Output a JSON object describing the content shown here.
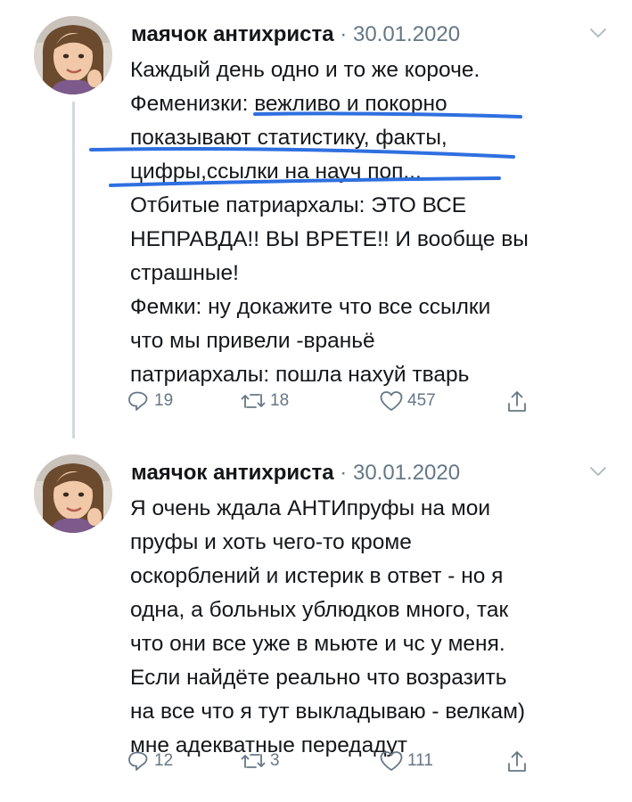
{
  "tweets": [
    {
      "author_name": "маячок антихриста",
      "separator": "·",
      "date": "30.01.2020",
      "lines": [
        "Каждый день одно и то же короче.",
        "Феменизки: вежливо и покорно",
        "показывают статистику, факты,",
        "цифры,ссылки на науч поп...",
        "Отбитые патриархалы: ЭТО ВСЕ",
        "НЕПРАВДА!! ВЫ ВРЕТЕ!! И вообще вы",
        "страшные!",
        "Фемки: ну докажите что все ссылки",
        "что мы привели -враньё",
        "патриархалы: пошла нахуй тварь"
      ],
      "replies": "19",
      "retweets": "18",
      "likes": "457",
      "icons": {
        "reply": "reply-icon",
        "retweet": "retweet-icon",
        "like": "heart-icon",
        "share": "share-icon",
        "menu": "chevron-down-icon"
      }
    },
    {
      "author_name": "маячок антихриста",
      "separator": "·",
      "date": "30.01.2020",
      "lines": [
        "Я очень ждала АНТИпруфы на мои",
        "пруфы и хоть чего-то кроме",
        "оскорблений и истерик в ответ - но я",
        "одна, а больных ублюдков много, так",
        "что они все уже в мьюте и чс у меня.",
        "Если найдёте реально что возразить",
        "на все что я тут выкладываю - велкам)",
        "мне адекватные передадут"
      ],
      "replies": "12",
      "retweets": "3",
      "likes": "111",
      "icons": {
        "reply": "reply-icon",
        "retweet": "retweet-icon",
        "like": "heart-icon",
        "share": "share-icon",
        "menu": "chevron-down-icon"
      }
    }
  ],
  "colors": {
    "text": "#14171a",
    "secondary": "#657786",
    "thread_line": "#cfd9de",
    "highlight_marker": "#2f6fe0"
  }
}
